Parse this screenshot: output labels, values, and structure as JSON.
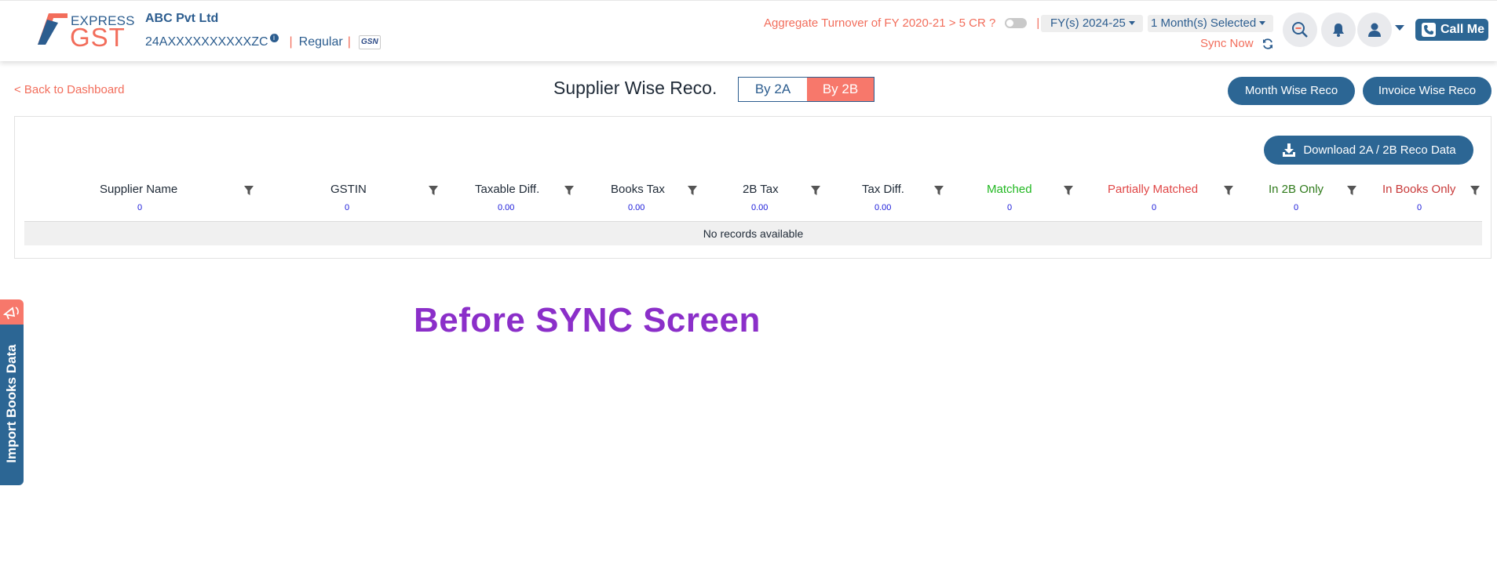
{
  "header": {
    "logo": {
      "top_text": "EXPRESS",
      "main_text": "GST"
    },
    "company_name": "ABC Pvt Ltd",
    "gstin": "24AXXXXXXXXXXZC",
    "info_icon": "i",
    "separator": "|",
    "registration_type": "Regular",
    "gsn_badge": "GSN",
    "turnover_question": "Aggregate Turnover of FY 2020-21 > 5 CR ?",
    "fy_select": "FY(s) 2024-25",
    "month_select": "1 Month(s) Selected",
    "sync_label": "Sync Now",
    "call_label": "Call Me",
    "icons": [
      "search-zoom-icon",
      "bell-icon",
      "user-icon",
      "phone-icon",
      "sync-icon"
    ]
  },
  "toolbar": {
    "back_link": "< Back to Dashboard",
    "title": "Supplier Wise Reco.",
    "toggle_a": "By 2A",
    "toggle_b": "By 2B",
    "month_wise": "Month Wise Reco",
    "invoice_wise": "Invoice Wise Reco",
    "download": "Download 2A / 2B Reco Data"
  },
  "table": {
    "columns": [
      {
        "label": "Supplier Name",
        "total": "0"
      },
      {
        "label": "GSTIN",
        "total": "0"
      },
      {
        "label": "Taxable Diff.",
        "total": "0.00"
      },
      {
        "label": "Books Tax",
        "total": "0.00"
      },
      {
        "label": "2B Tax",
        "total": "0.00"
      },
      {
        "label": "Tax Diff.",
        "total": "0.00"
      },
      {
        "label": "Matched",
        "total": "0"
      },
      {
        "label": "Partially Matched",
        "total": "0"
      },
      {
        "label": "In 2B Only",
        "total": "0"
      },
      {
        "label": "In Books Only",
        "total": "0"
      }
    ],
    "empty_message": "No records available"
  },
  "side_tab": {
    "label": "Import Books Data"
  },
  "caption": "Before SYNC Screen",
  "colors": {
    "brand_blue": "#2c6694",
    "brand_coral": "#f26d5b",
    "matched": "#22b822",
    "partially_matched": "#e04646",
    "in_2b_only": "#2f7a1b",
    "in_books_only": "#c83a3a",
    "caption": "#8b2fc9"
  }
}
